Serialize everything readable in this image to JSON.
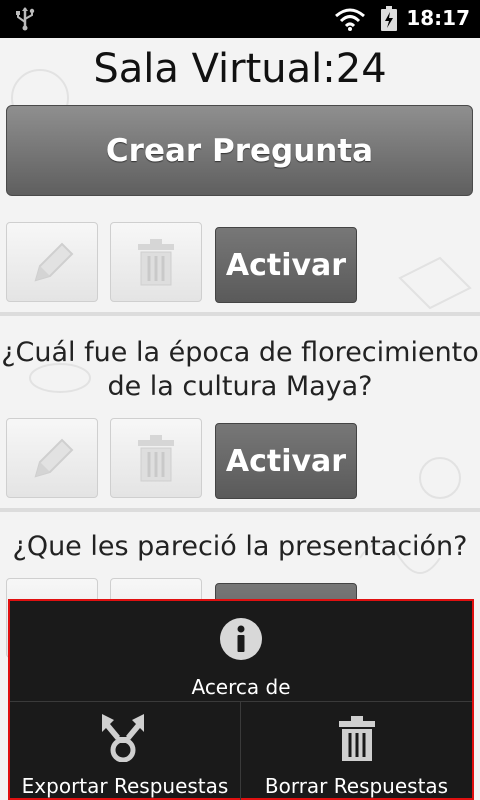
{
  "status_bar": {
    "time": "18:17"
  },
  "room_title": "Sala Virtual:24",
  "create_button": "Crear Pregunta",
  "questions": [
    {
      "text": "",
      "activate_label": "Activar"
    },
    {
      "text": "¿Cuál fue la época de florecimiento de la cultura Maya?",
      "activate_label": "Activar"
    },
    {
      "text": "¿Que les pareció la presentación?",
      "activate_label": ""
    }
  ],
  "menu": {
    "about": "Acerca de",
    "export": "Exportar Respuestas",
    "delete": "Borrar Respuestas"
  },
  "colors": {
    "menu_border": "#e01010",
    "button_dark": "#5f5f5f"
  }
}
